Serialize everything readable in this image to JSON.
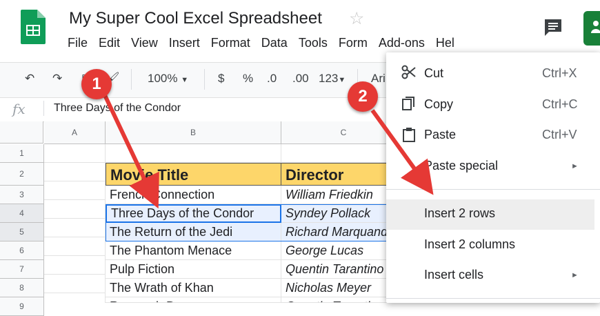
{
  "doc": {
    "title": "My Super Cool Excel Spreadsheet",
    "menu": [
      "File",
      "Edit",
      "View",
      "Insert",
      "Format",
      "Data",
      "Tools",
      "Form",
      "Add-ons",
      "Hel"
    ]
  },
  "toolbar": {
    "zoom": "100%",
    "currency": "$",
    "percent": "%",
    "dec_less": ".0",
    "dec_more": ".00",
    "number_format": "123",
    "font": "Ari"
  },
  "formula_bar": {
    "fx": "fx",
    "content": "Three Days of the Condor"
  },
  "grid": {
    "columns": [
      "A",
      "B",
      "C"
    ],
    "row_numbers": [
      "1",
      "2",
      "3",
      "4",
      "5",
      "6",
      "7",
      "8",
      "9"
    ],
    "header_row": {
      "title": "Movie Title",
      "director": "Director"
    },
    "rows": [
      {
        "title": "French Connection",
        "director": "William Friedkin"
      },
      {
        "title": "Three Days of the Condor",
        "director": "Syndey Pollack"
      },
      {
        "title": "The Return of the Jedi",
        "director": "Richard Marquand"
      },
      {
        "title": "The Phantom Menace",
        "director": "George Lucas"
      },
      {
        "title": "Pulp Fiction",
        "director": "Quentin Tarantino"
      },
      {
        "title": "The Wrath of Khan",
        "director": "Nicholas Meyer"
      },
      {
        "title": "Reservoir Dogs",
        "director": "Quentin Tarantino"
      }
    ]
  },
  "context_menu": {
    "cut": {
      "label": "Cut",
      "shortcut": "Ctrl+X"
    },
    "copy": {
      "label": "Copy",
      "shortcut": "Ctrl+C"
    },
    "paste": {
      "label": "Paste",
      "shortcut": "Ctrl+V"
    },
    "paste_special": {
      "label": "Paste special"
    },
    "insert_rows": {
      "label": "Insert 2 rows"
    },
    "insert_columns": {
      "label": "Insert 2 columns"
    },
    "insert_cells": {
      "label": "Insert cells"
    }
  },
  "callouts": [
    "1",
    "2"
  ],
  "colors": {
    "header_fill": "#fdd66a",
    "selection": "#1a73e8",
    "callout": "#e53935",
    "sheets_green": "#0f9d58"
  }
}
